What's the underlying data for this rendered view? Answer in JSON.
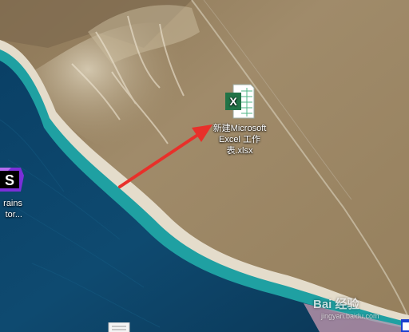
{
  "desktop": {
    "icons": [
      {
        "label": "新建Microsoft Excel 工作表.xlsx",
        "icon": "excel-file-icon"
      },
      {
        "label": "JetBrains Toolbox...",
        "label_line1": "rains",
        "label_line2": "tor...",
        "icon": "jetbrains-toolbox-icon"
      },
      {
        "icon": "document-icon"
      }
    ]
  },
  "annotation": {
    "type": "arrow",
    "color": "#e8302a"
  },
  "watermark": {
    "logo_text": "Bai 经验",
    "url": "jingyan.baidu.com"
  },
  "colors": {
    "excel_green": "#217346",
    "jetbrains_purple": "#7b2fd8",
    "ocean": "#0f4a6e",
    "shallow_water": "#1d9aa0",
    "desert": "#9e8a68"
  }
}
